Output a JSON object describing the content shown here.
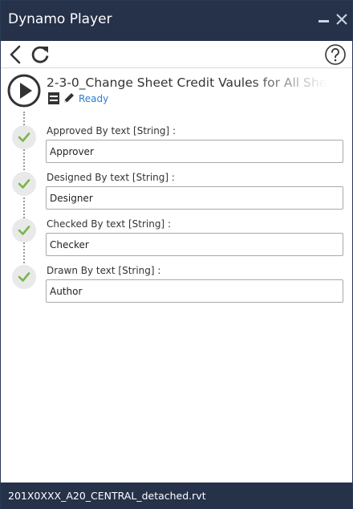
{
  "window": {
    "title": "Dynamo Player"
  },
  "toolbar": {
    "back_icon": "back-arrow-icon",
    "refresh_icon": "refresh-icon",
    "help_icon": "help-icon"
  },
  "script": {
    "name": "2-3-0_Change Sheet Credit Vaules for All Shee",
    "status": "Ready",
    "status_color": "#2a7fd4"
  },
  "inputs": [
    {
      "label": "Approved By text [String] :",
      "value": "Approver"
    },
    {
      "label": "Designed By text [String] :",
      "value": "Designer"
    },
    {
      "label": "Checked By text [String] :",
      "value": "Checker"
    },
    {
      "label": "Drawn By text [String] :",
      "value": "Author"
    }
  ],
  "footer": {
    "file_name": "201X0XXX_A20_CENTRAL_detached.rvt"
  },
  "colors": {
    "titlebar": "#26324a",
    "check": "#7ab648",
    "accent": "#2a7fd4"
  }
}
